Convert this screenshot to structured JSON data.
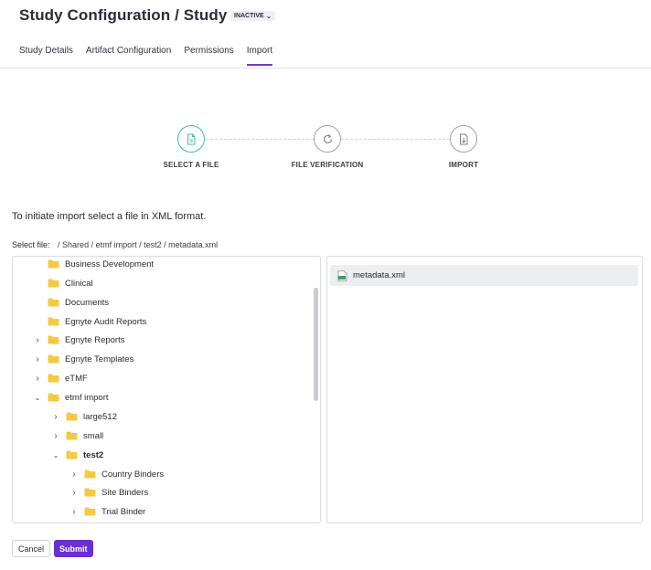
{
  "header": {
    "title": "Study Configuration / Study",
    "status": "INACTIVE",
    "status_icon": "chevron-down-icon"
  },
  "tabs": [
    {
      "label": "Study Details",
      "active": false
    },
    {
      "label": "Artifact Configuration",
      "active": false
    },
    {
      "label": "Permissions",
      "active": false
    },
    {
      "label": "Import",
      "active": true
    }
  ],
  "stepper": {
    "steps": [
      {
        "label": "SELECT A FILE",
        "icon": "document-icon",
        "active": true
      },
      {
        "label": "FILE VERIFICATION",
        "icon": "refresh-icon",
        "active": false
      },
      {
        "label": "IMPORT",
        "icon": "import-icon",
        "active": false
      }
    ],
    "active_color": "#3fbcad"
  },
  "instruction": "To initiate import select a file in XML format.",
  "select_file": {
    "label": "Select file:",
    "path": "/ Shared / etmf import / test2 / metadata.xml"
  },
  "tree": {
    "items": [
      {
        "label": "Business Development",
        "chevron": ""
      },
      {
        "label": "Clinical",
        "chevron": ""
      },
      {
        "label": "Documents",
        "chevron": ""
      },
      {
        "label": "Egnyte Audit Reports",
        "chevron": ""
      },
      {
        "label": "Egnyte Reports",
        "chevron": ">"
      },
      {
        "label": "Egnyte Templates",
        "chevron": ">"
      },
      {
        "label": "eTMF",
        "chevron": ">"
      },
      {
        "label": "etmf import",
        "chevron": "v"
      },
      {
        "label": "large512",
        "chevron": ">"
      },
      {
        "label": "small",
        "chevron": ">"
      },
      {
        "label": "test2",
        "chevron": "v"
      },
      {
        "label": "Country Binders",
        "chevron": ">"
      },
      {
        "label": "Site Binders",
        "chevron": ">"
      },
      {
        "label": "Trial Binder",
        "chevron": ">"
      }
    ],
    "folder_color": "#f6c944"
  },
  "files": [
    {
      "name": "metadata.xml",
      "icon": "xml-file-icon"
    }
  ],
  "buttons": {
    "cancel": "Cancel",
    "submit": "Submit"
  },
  "colors": {
    "accent": "#6a2fd1",
    "tab_underline": "#6b3fbe"
  }
}
